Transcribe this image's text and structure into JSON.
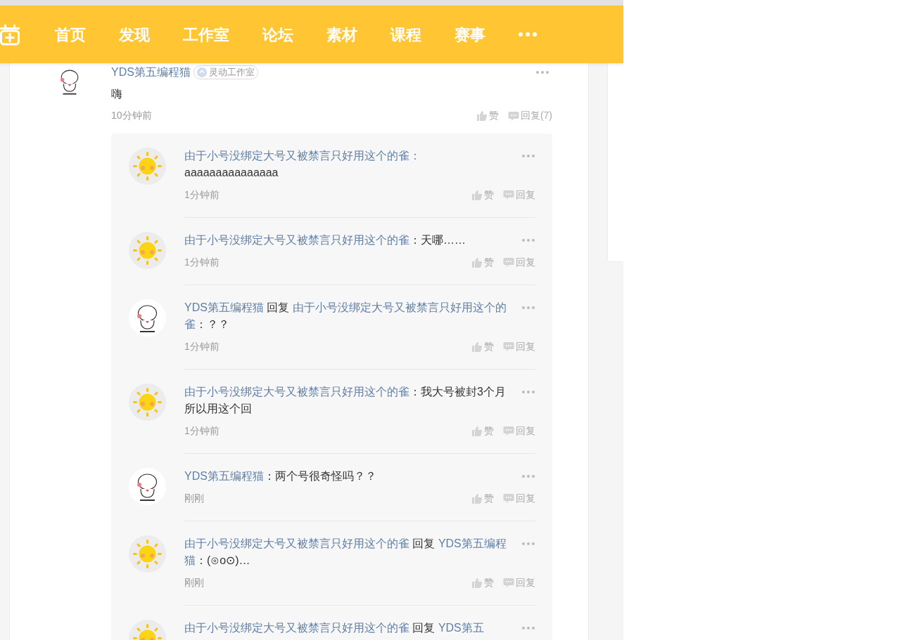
{
  "nav": {
    "items": [
      "首页",
      "发现",
      "工作室",
      "论坛",
      "素材",
      "课程",
      "赛事"
    ]
  },
  "post": {
    "kind": "mochi",
    "author": "YDS第五编程猫",
    "badge": "灵动工作室",
    "content": "嗨",
    "time": "10分钟前",
    "like": "赞",
    "reply": "回复(7)"
  },
  "replies": [
    {
      "kind": "sun",
      "segments": [
        {
          "kind": "user",
          "text": "由于小号没绑定大号又被禁言只好用这个的雀"
        },
        {
          "kind": "user",
          "text": "："
        },
        {
          "kind": "plain",
          "text": "aaaaaaaaaaaaaaa"
        }
      ],
      "time": "1分钟前",
      "like": "赞",
      "reply": "回复"
    },
    {
      "kind": "sun",
      "segments": [
        {
          "kind": "user",
          "text": "由于小号没绑定大号又被禁言只好用这个的雀"
        },
        {
          "kind": "plain",
          "text": "：天哪……"
        }
      ],
      "time": "1分钟前",
      "like": "赞",
      "reply": "回复"
    },
    {
      "kind": "mochi",
      "segments": [
        {
          "kind": "user",
          "text": "YDS第五编程猫"
        },
        {
          "kind": "plain",
          "text": " 回复 "
        },
        {
          "kind": "user",
          "text": "由于小号没绑定大号又被禁言只好用这个的雀"
        },
        {
          "kind": "plain",
          "text": "：？？"
        }
      ],
      "time": "1分钟前",
      "like": "赞",
      "reply": "回复"
    },
    {
      "kind": "sun",
      "segments": [
        {
          "kind": "user",
          "text": "由于小号没绑定大号又被禁言只好用这个的雀"
        },
        {
          "kind": "plain",
          "text": "：我大号被封3个月所以用这个回"
        }
      ],
      "time": "1分钟前",
      "like": "赞",
      "reply": "回复"
    },
    {
      "kind": "mochi",
      "segments": [
        {
          "kind": "user",
          "text": "YDS第五编程猫"
        },
        {
          "kind": "plain",
          "text": "：两个号很奇怪吗？？"
        }
      ],
      "time": "刚刚",
      "like": "赞",
      "reply": "回复"
    },
    {
      "kind": "sun",
      "segments": [
        {
          "kind": "user",
          "text": "由于小号没绑定大号又被禁言只好用这个的雀"
        },
        {
          "kind": "plain",
          "text": " 回复 "
        },
        {
          "kind": "user",
          "text": "YDS第五编程猫"
        },
        {
          "kind": "plain",
          "text": "：(⊙o⊙)…"
        }
      ],
      "time": "刚刚",
      "like": "赞",
      "reply": "回复"
    },
    {
      "kind": "sun",
      "segments": [
        {
          "kind": "user",
          "text": "由于小号没绑定大号又被禁言只好用这个的雀"
        },
        {
          "kind": "plain",
          "text": " 回复 "
        },
        {
          "kind": "user",
          "text": "YDS第五"
        }
      ]
    }
  ]
}
